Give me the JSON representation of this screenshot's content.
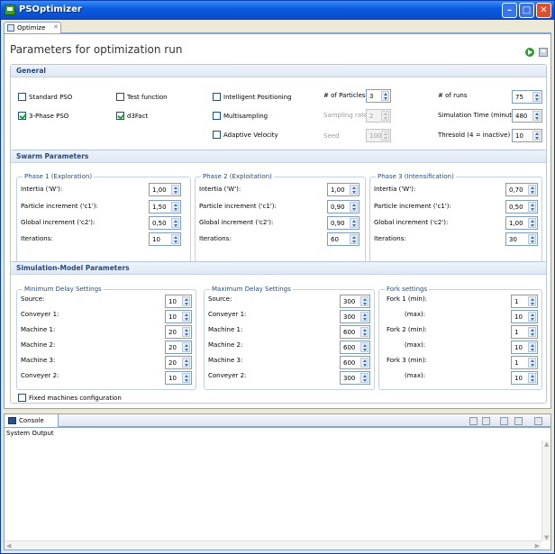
{
  "window": {
    "title": "PSOptimizer"
  },
  "editor_tab": {
    "label": "Optimize",
    "close": "✕"
  },
  "form": {
    "title": "Parameters for optimization run"
  },
  "general": {
    "title": "General",
    "standard_pso": {
      "label": "Standard PSO",
      "checked": false
    },
    "three_phase_pso": {
      "label": "3-Phase PSO",
      "checked": true
    },
    "test_function": {
      "label": "Test function",
      "checked": false
    },
    "d3fact": {
      "label": "d3Fact",
      "checked": true
    },
    "intelligent_positioning": {
      "label": "Intelligent Positioning",
      "checked": false
    },
    "multisampling": {
      "label": "Multisampling",
      "checked": false
    },
    "adaptive_velocity": {
      "label": "Adaptive Velocity",
      "checked": false
    },
    "num_particles": {
      "label": "# of Particles",
      "value": "3"
    },
    "sampling_rate": {
      "label": "Sampling rate",
      "value": "2"
    },
    "seed": {
      "label": "Seed",
      "value": "100"
    },
    "num_runs": {
      "label": "# of runs",
      "value": "75"
    },
    "simulation_time": {
      "label": "Simulation Time (minutes)",
      "value": "480"
    },
    "threshold": {
      "label": "Thresold (4 = inactive)",
      "value": "10"
    }
  },
  "swarm": {
    "title": "Swarm Parameters",
    "labels": {
      "inertia": "Intertia ('W'):",
      "particle": "Particle increment ('c1'):",
      "global": "Global increment ('c2'):",
      "iterations": "Iterations:"
    },
    "phase1": {
      "title": "Phase 1 (Exploration)",
      "inertia": "1,00",
      "particle": "1,50",
      "global": "0,50",
      "iterations": "10"
    },
    "phase2": {
      "title": "Phase 2 (Exploitation)",
      "inertia": "1,00",
      "particle": "0,90",
      "global": "0,90",
      "iterations": "60"
    },
    "phase3": {
      "title": "Phase 3 (Intensification)",
      "inertia": "0,70",
      "particle": "0,50",
      "global": "1,00",
      "iterations": "30"
    }
  },
  "simulation": {
    "title": "Simulation-Model Parameters",
    "labels": {
      "source": "Source:",
      "conveyer1": "Conveyer 1:",
      "machine1": "Machine 1:",
      "machine2": "Machine 2:",
      "machine3": "Machine 3:",
      "conveyer2": "Conveyer 2:"
    },
    "min_delay": {
      "title": "Minimum Delay Settings",
      "source": "10",
      "conveyer1": "10",
      "machine1": "20",
      "machine2": "20",
      "machine3": "20",
      "conveyer2": "10"
    },
    "max_delay": {
      "title": "Maximum Delay Settings",
      "source": "300",
      "conveyer1": "300",
      "machine1": "600",
      "machine2": "600",
      "machine3": "600",
      "conveyer2": "300"
    },
    "fork": {
      "title": "Fork settings",
      "fork1_min_label": "Fork 1 (min):",
      "fork1_min": "1",
      "fork1_max_label": "(max):",
      "fork1_max": "10",
      "fork2_min_label": "Fork 2 (min):",
      "fork2_min": "1",
      "fork2_max_label": "(max):",
      "fork2_max": "10",
      "fork3_min_label": "Fork 3 (min):",
      "fork3_min": "1",
      "fork3_max_label": "(max):",
      "fork3_max": "10"
    },
    "fixed_machines": {
      "label": "Fixed machines configuration",
      "checked": false
    }
  },
  "console": {
    "tab_label": "Console",
    "subtitle": "System Output"
  },
  "colors": {
    "title_bar": "#0b4fd0",
    "section_title": "#2a4a7a",
    "checkbox_check": "#21a121"
  }
}
